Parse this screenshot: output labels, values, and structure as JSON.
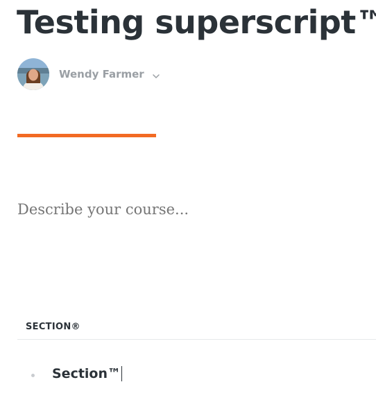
{
  "course": {
    "title": "Testing superscript™",
    "description_placeholder": "Describe your course..."
  },
  "author": {
    "name": "Wendy Farmer",
    "avatar_icon": "user-avatar",
    "dropdown_icon": "chevron-down-icon"
  },
  "colors": {
    "accent": "#f26a23",
    "title": "#2b3238",
    "muted": "#9a9fa4"
  },
  "curriculum": {
    "section_label": "SECTION®",
    "items": [
      {
        "label": "Section™"
      }
    ]
  }
}
